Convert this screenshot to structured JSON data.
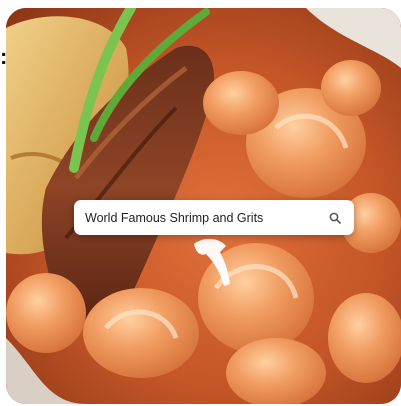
{
  "search": {
    "query": "World Famous Shrimp and Grits",
    "icon": "search-icon"
  },
  "colors": {
    "chip_background": "#ffffff",
    "chip_text": "#1f1f1f"
  }
}
